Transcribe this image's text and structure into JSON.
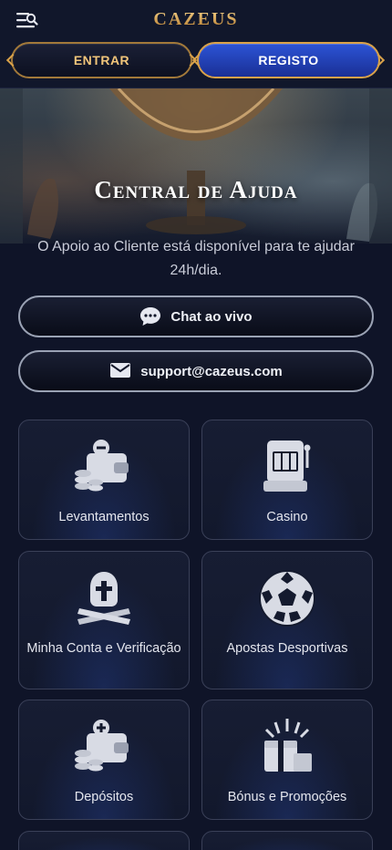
{
  "header": {
    "logo": "CAZEUS",
    "login_label": "ENTRAR",
    "register_label": "REGISTO"
  },
  "hero": {
    "title": "Central de Ajuda",
    "subtitle": "O Apoio ao Cliente está disponível para te ajudar 24h/dia."
  },
  "contact": {
    "chat_label": "Chat ao vivo",
    "email_label": "support@cazeus.com"
  },
  "categories": [
    {
      "label": "Levantamentos",
      "icon": "wallet-withdraw-icon"
    },
    {
      "label": "Casino",
      "icon": "slot-machine-icon"
    },
    {
      "label": "Minha Conta e Verificação",
      "icon": "spartan-helmet-icon"
    },
    {
      "label": "Apostas Desportivas",
      "icon": "soccer-ball-icon"
    },
    {
      "label": "Depósitos",
      "icon": "wallet-deposit-icon"
    },
    {
      "label": "Bónus e Promoções",
      "icon": "gift-bonus-icon"
    }
  ],
  "colors": {
    "background": "#0f1428",
    "gold": "#d9a24a",
    "register_blue": "#2c54d6"
  }
}
